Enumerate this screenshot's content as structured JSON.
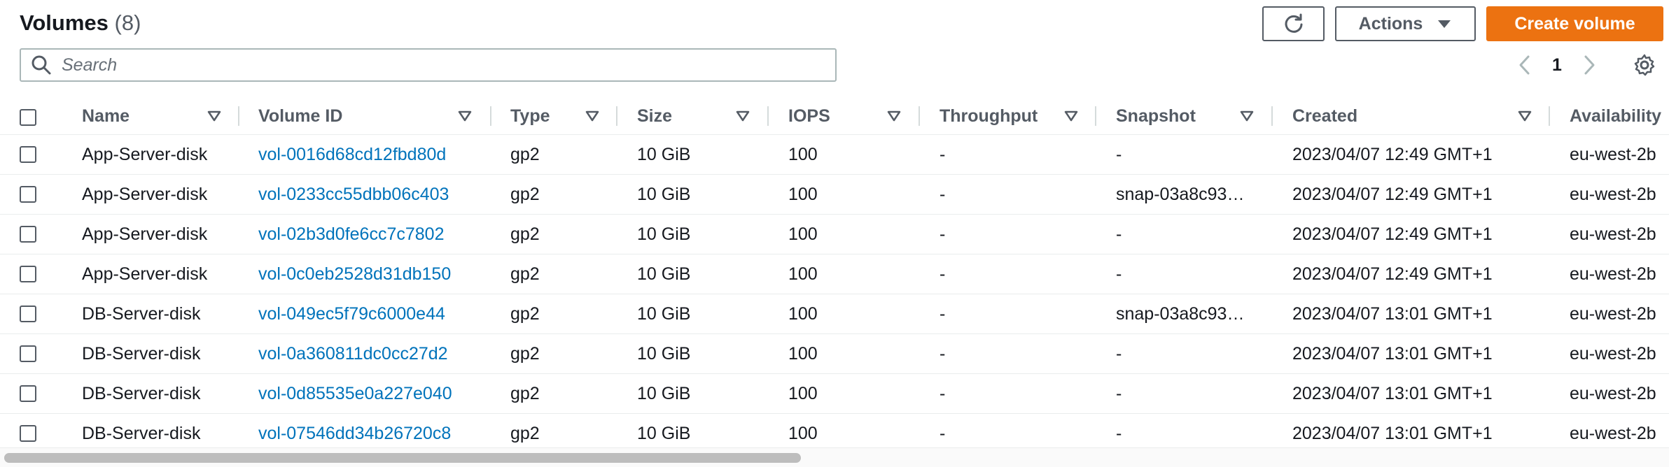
{
  "header": {
    "title": "Volumes",
    "count": "(8)",
    "actions_label": "Actions",
    "create_label": "Create volume"
  },
  "search": {
    "placeholder": "Search",
    "value": ""
  },
  "pagination": {
    "page": "1"
  },
  "colors": {
    "primary": "#ec7211",
    "link": "#0073bb",
    "text": "#16191f",
    "muted": "#545b64",
    "border": "#eaeded"
  },
  "icons": {
    "refresh": "refresh-icon",
    "actions_caret": "caret-down-icon",
    "search": "search-icon",
    "prev": "chevron-left-icon",
    "next": "chevron-right-icon",
    "settings": "gear-icon",
    "sort": "sort-down-icon"
  },
  "columns": [
    "Name",
    "Volume ID",
    "Type",
    "Size",
    "IOPS",
    "Throughput",
    "Snapshot",
    "Created",
    "Availability"
  ],
  "rows": [
    {
      "name": "App-Server-disk",
      "volume_id": "vol-0016d68cd12fbd80d",
      "type": "gp2",
      "size": "10 GiB",
      "iops": "100",
      "throughput": "-",
      "snapshot": "-",
      "created": "2023/04/07 12:49 GMT+1",
      "az": "eu-west-2b"
    },
    {
      "name": "App-Server-disk",
      "volume_id": "vol-0233cc55dbb06c403",
      "type": "gp2",
      "size": "10 GiB",
      "iops": "100",
      "throughput": "-",
      "snapshot": "snap-03a8c93…",
      "created": "2023/04/07 12:49 GMT+1",
      "az": "eu-west-2b"
    },
    {
      "name": "App-Server-disk",
      "volume_id": "vol-02b3d0fe6cc7c7802",
      "type": "gp2",
      "size": "10 GiB",
      "iops": "100",
      "throughput": "-",
      "snapshot": "-",
      "created": "2023/04/07 12:49 GMT+1",
      "az": "eu-west-2b"
    },
    {
      "name": "App-Server-disk",
      "volume_id": "vol-0c0eb2528d31db150",
      "type": "gp2",
      "size": "10 GiB",
      "iops": "100",
      "throughput": "-",
      "snapshot": "-",
      "created": "2023/04/07 12:49 GMT+1",
      "az": "eu-west-2b"
    },
    {
      "name": "DB-Server-disk",
      "volume_id": "vol-049ec5f79c6000e44",
      "type": "gp2",
      "size": "10 GiB",
      "iops": "100",
      "throughput": "-",
      "snapshot": "snap-03a8c93…",
      "created": "2023/04/07 13:01 GMT+1",
      "az": "eu-west-2b"
    },
    {
      "name": "DB-Server-disk",
      "volume_id": "vol-0a360811dc0cc27d2",
      "type": "gp2",
      "size": "10 GiB",
      "iops": "100",
      "throughput": "-",
      "snapshot": "-",
      "created": "2023/04/07 13:01 GMT+1",
      "az": "eu-west-2b"
    },
    {
      "name": "DB-Server-disk",
      "volume_id": "vol-0d85535e0a227e040",
      "type": "gp2",
      "size": "10 GiB",
      "iops": "100",
      "throughput": "-",
      "snapshot": "-",
      "created": "2023/04/07 13:01 GMT+1",
      "az": "eu-west-2b"
    },
    {
      "name": "DB-Server-disk",
      "volume_id": "vol-07546dd34b26720c8",
      "type": "gp2",
      "size": "10 GiB",
      "iops": "100",
      "throughput": "-",
      "snapshot": "-",
      "created": "2023/04/07 13:01 GMT+1",
      "az": "eu-west-2b"
    }
  ]
}
